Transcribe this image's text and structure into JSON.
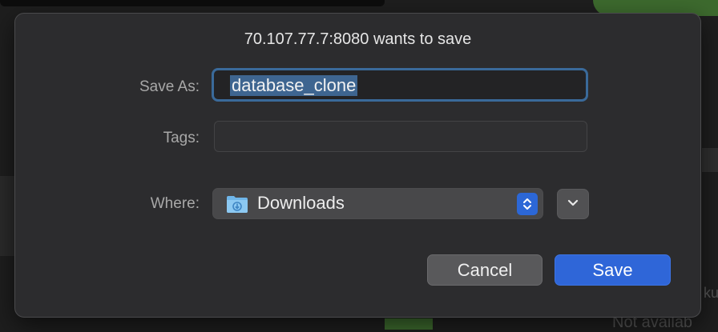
{
  "dialog": {
    "title": "70.107.77.7:8080 wants to save",
    "save_as_label": "Save As:",
    "save_as_value": "database_clone",
    "tags_label": "Tags:",
    "tags_value": "",
    "where_label": "Where:",
    "where_value": "Downloads",
    "where_icon": "downloads-folder-icon",
    "stepper_icon": "up-down-chevron-icon",
    "expand_icon": "chevron-down-icon",
    "cancel_label": "Cancel",
    "save_label": "Save"
  },
  "background": {
    "partial_text": "Not availab",
    "partial_text_2": "ku"
  },
  "colors": {
    "accent": "#2f66d8",
    "selection": "#3e6590",
    "focus_ring": "#3a6a9a",
    "sheet": "#2c2c2e"
  }
}
